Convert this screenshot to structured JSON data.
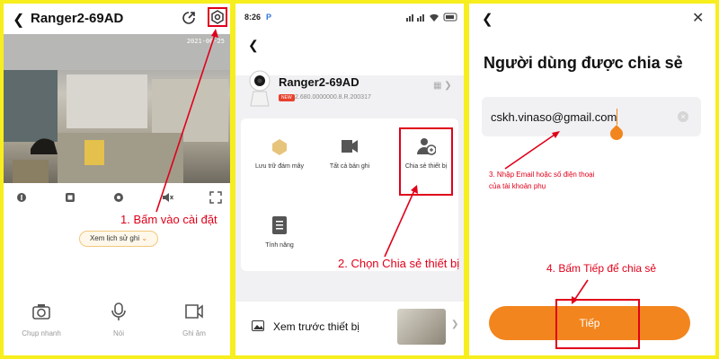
{
  "panel1": {
    "title": "Ranger2-69AD",
    "timestamp": "2021-06-25",
    "history_button": "Xem lịch sử ghi",
    "bottom_actions": [
      {
        "label": "Chụp nhanh",
        "icon": "camera-icon"
      },
      {
        "label": "Nói",
        "icon": "microphone-icon"
      },
      {
        "label": "Ghi âm",
        "icon": "video-record-icon"
      }
    ],
    "annotation": "1. Bấm vào cài đặt"
  },
  "panel2": {
    "status_time": "8:26",
    "status_p": "P",
    "device_name": "Ranger2-69AD",
    "new_badge": "NEW",
    "version": "2.680.0000000.8.R.200317",
    "features": [
      {
        "label": "Lưu trữ đám mây",
        "icon": "cloud-storage-icon"
      },
      {
        "label": "Tất cả bản ghi",
        "icon": "recordings-icon"
      },
      {
        "label": "Chia sẻ thiết bị",
        "icon": "share-device-icon"
      },
      {
        "label": "Tính năng",
        "icon": "features-icon"
      }
    ],
    "preview_label": "Xem trước thiết bị",
    "annotation": "2. Chọn Chia sẻ thiết bị"
  },
  "panel3": {
    "title": "Người dùng được chia sẻ",
    "email_value": "cskh.vinaso@gmail.com",
    "annotation_email_1": "3. Nhập Email hoặc số điện thoại",
    "annotation_email_2": "của tài khoản phụ",
    "annotation_next": "4. Bấm Tiếp để chia sẻ",
    "next_button": "Tiếp"
  },
  "colors": {
    "accent": "#f2851e",
    "annotation": "#e0001a",
    "frame": "#f7ee1e"
  }
}
